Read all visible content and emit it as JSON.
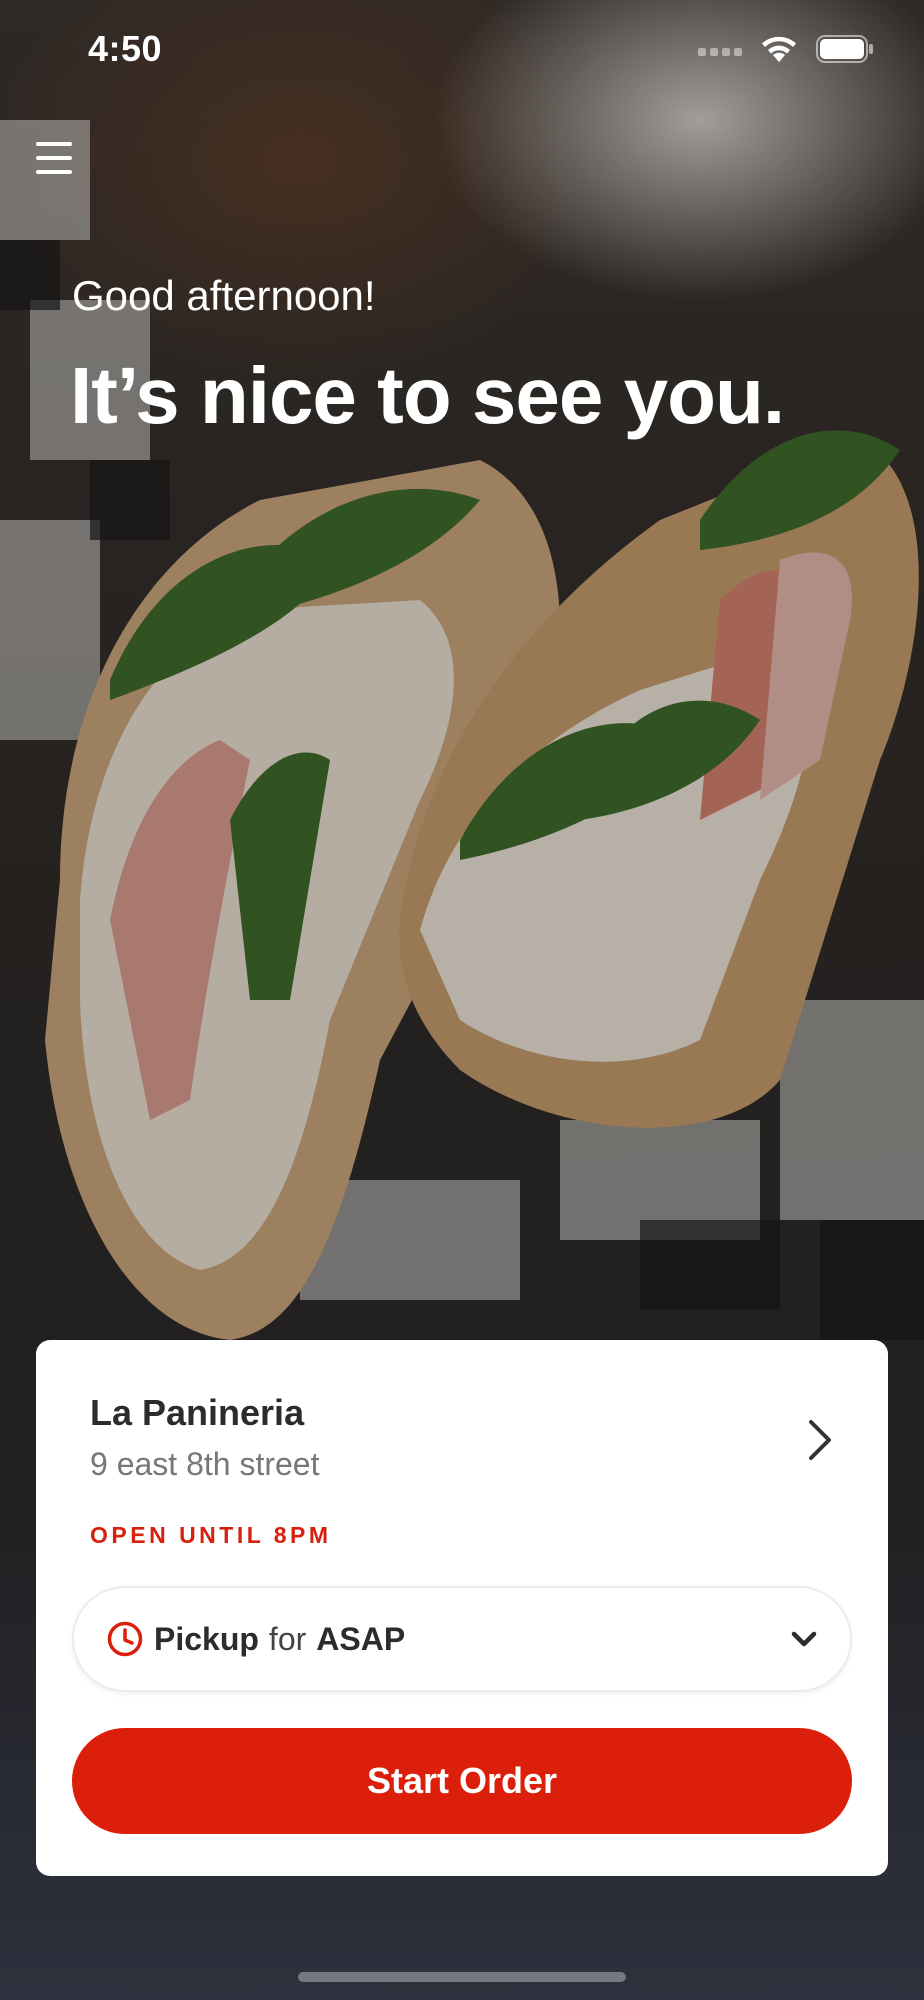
{
  "status_bar": {
    "time": "4:50",
    "icons": [
      "signal-icon",
      "wifi-icon",
      "battery-icon"
    ]
  },
  "menu": {
    "icon": "hamburger-menu-icon"
  },
  "greeting": {
    "subtitle": "Good afternoon!",
    "title": "It’s nice to see you."
  },
  "store": {
    "name": "La Panineria",
    "address": "9 east 8th street",
    "hours": "OPEN UNTIL 8PM"
  },
  "order_mode": {
    "mode": "Pickup",
    "connector": "for",
    "time": "ASAP"
  },
  "start_order": {
    "label": "Start Order"
  },
  "colors": {
    "accent": "#db1f0a",
    "hours_text": "#d7200e",
    "card_bg": "#ffffff"
  }
}
